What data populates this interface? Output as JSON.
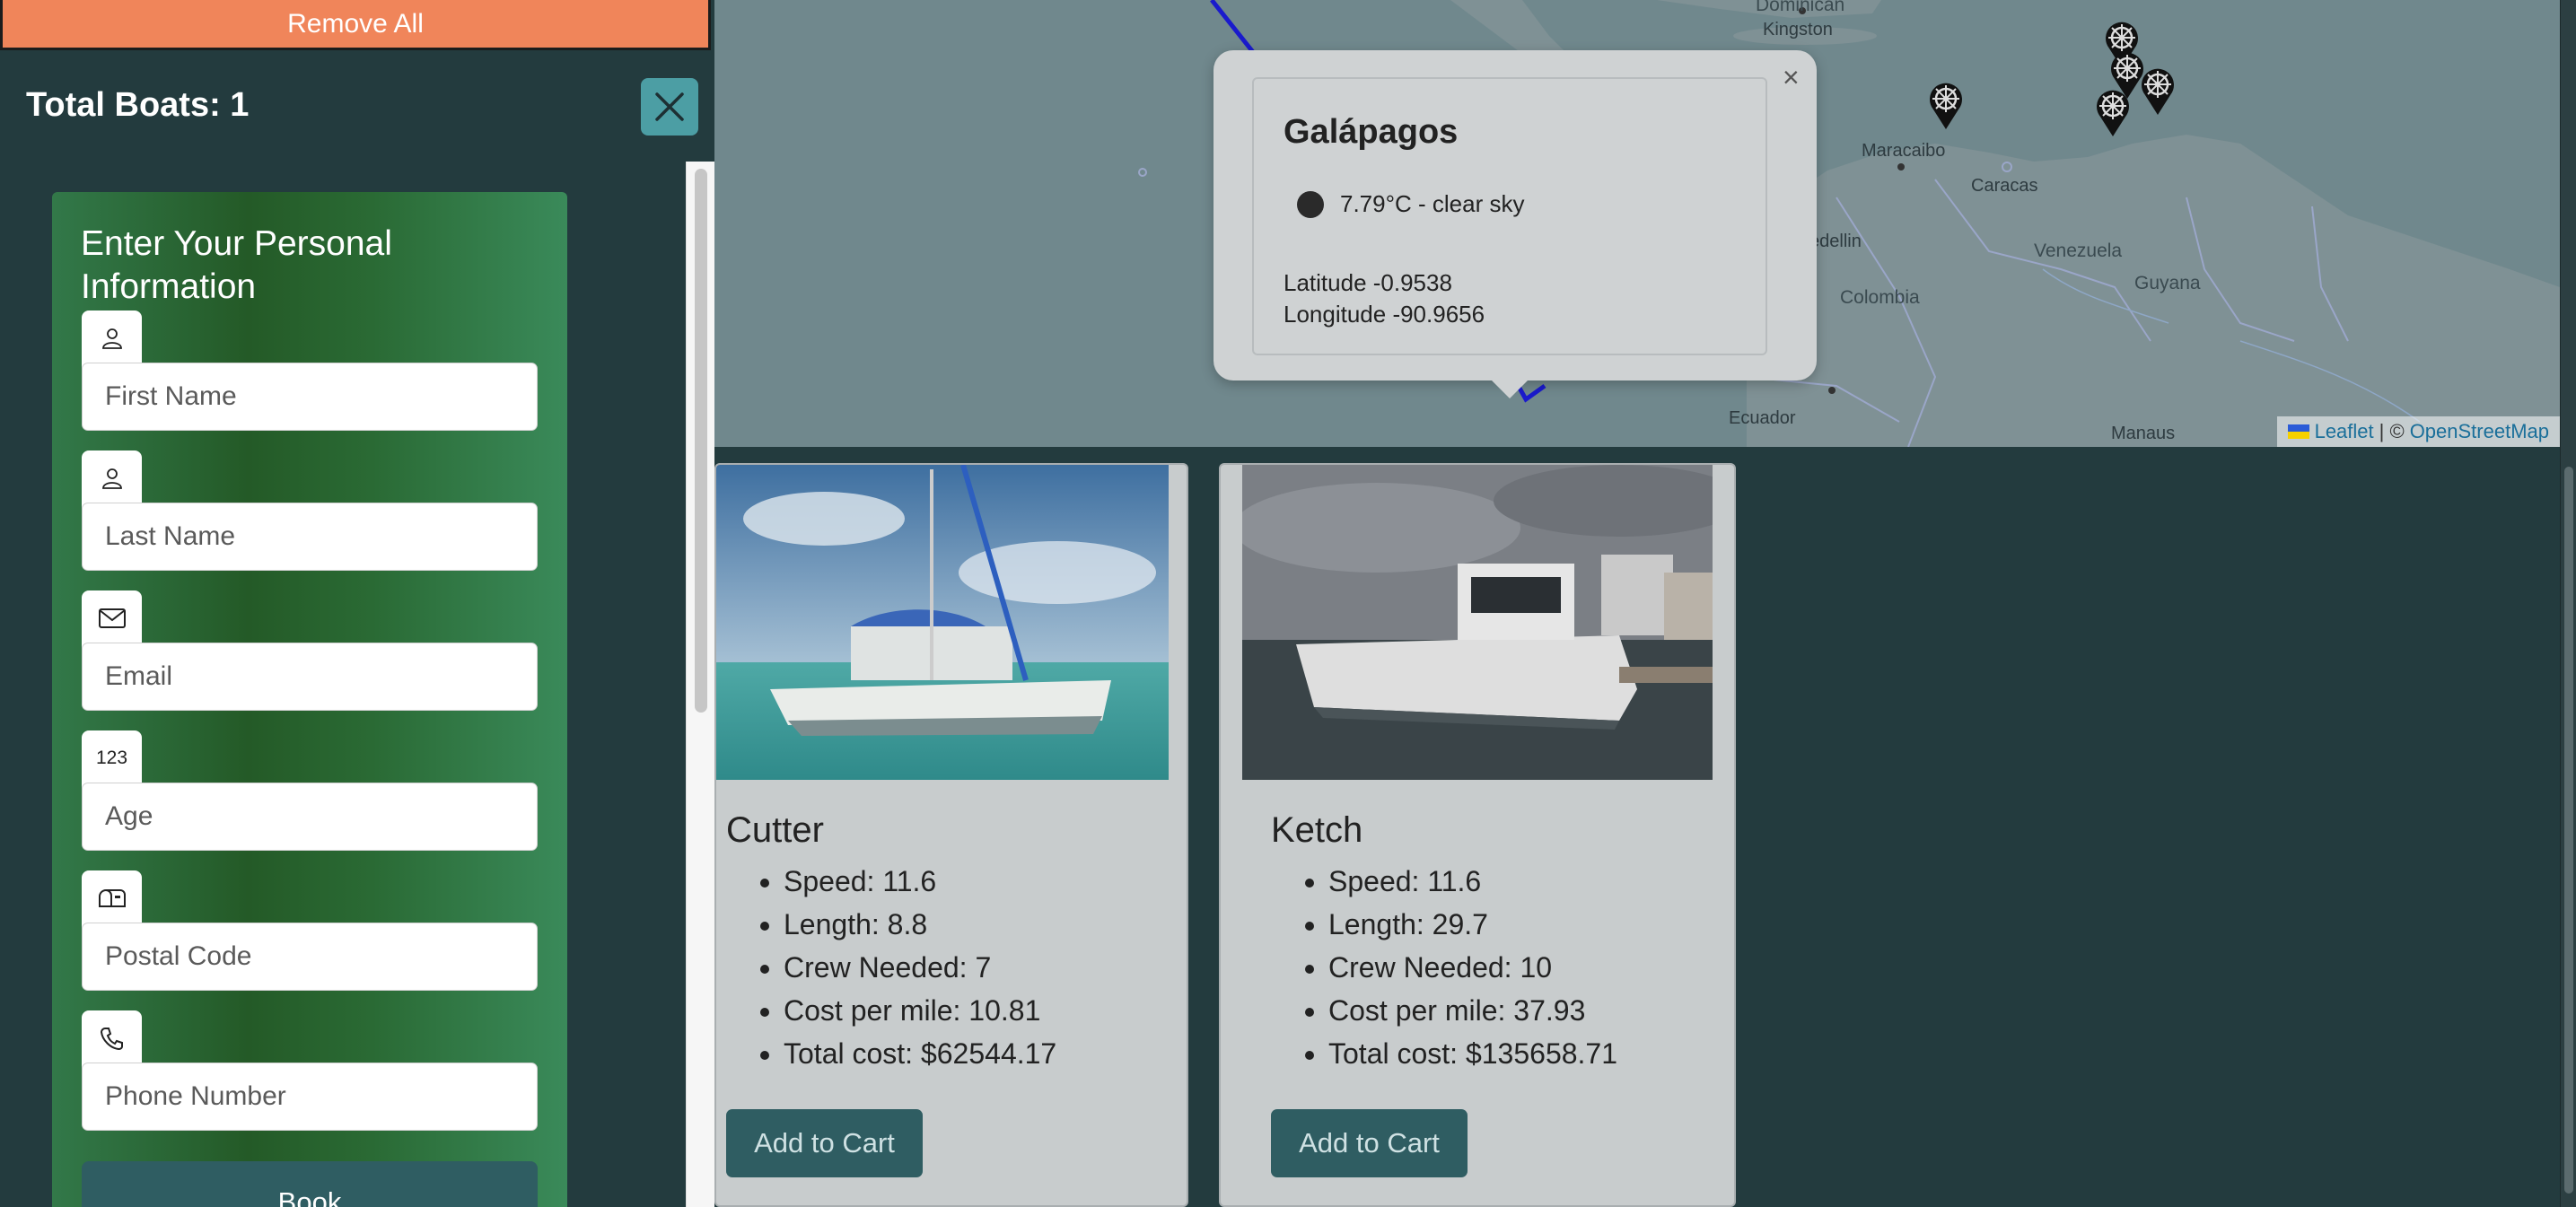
{
  "sidebar": {
    "remove_all_label": "Remove All",
    "total_boats": "Total Boats: 1",
    "form": {
      "title": "Enter Your Personal Information",
      "fields": {
        "first_name": "First Name",
        "last_name": "Last Name",
        "email": "Email",
        "age_icon": "123",
        "age": "Age",
        "postal_code": "Postal Code",
        "phone": "Phone Number"
      },
      "book_label": "Book"
    }
  },
  "map": {
    "labels": {
      "kingston": "Kingston",
      "maracaibo": "Maracaibo",
      "caracas": "Caracas",
      "venezuela": "Venezuela",
      "colombia": "Colombia",
      "guyana": "Guyana",
      "ecuador": "Ecuador",
      "manaus": "Manaus",
      "medellin_partial": "edellin",
      "dominican_partial": "Dominican"
    },
    "attribution": {
      "leaflet": "Leaflet",
      "separator": "| ©",
      "osm": "OpenStreetMap"
    },
    "popup": {
      "title": "Galápagos",
      "weather": "7.79°C - clear sky",
      "latitude": "Latitude -0.9538",
      "longitude": "Longitude -90.9656",
      "close": "×"
    }
  },
  "boats": [
    {
      "name": "Cutter",
      "speed": "Speed: 11.6",
      "length": "Length: 8.8",
      "crew": "Crew Needed: 7",
      "cost_per_mile": "Cost per mile: 10.81",
      "total_cost": "Total cost: $62544.17",
      "add_label": "Add to Cart"
    },
    {
      "name": "Ketch",
      "speed": "Speed: 11.6",
      "length": "Length: 29.7",
      "crew": "Crew Needed: 10",
      "cost_per_mile": "Cost per mile: 37.93",
      "total_cost": "Total cost: $135658.71",
      "add_label": "Add to Cart"
    }
  ],
  "colors": {
    "background": "#233b3e",
    "remove_all": "#f0855a",
    "close_button": "#4c9ea4",
    "primary_button": "#2f5d62",
    "route_line": "#1a1acc"
  }
}
